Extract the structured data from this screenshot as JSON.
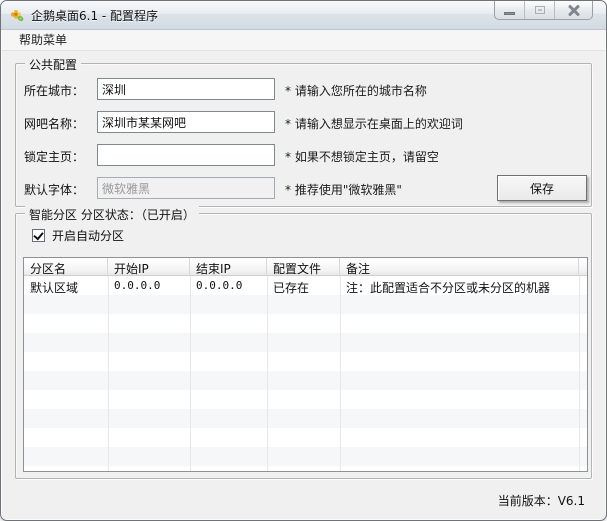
{
  "window": {
    "title": "企鹅桌面6.1 - 配置程序",
    "app_icon": "flower-icon",
    "controls": {
      "minimize": "minimize",
      "maximize": "maximize",
      "close": "close"
    }
  },
  "menu": {
    "help_label": "帮助菜单"
  },
  "common_config": {
    "title": "公共配置",
    "fields": [
      {
        "label": "所在城市：",
        "value": "深圳",
        "hint": "* 请输入您所在的城市名称"
      },
      {
        "label": "网吧名称：",
        "value": "深圳市某某网吧",
        "hint": "* 请输入想显示在桌面上的欢迎词"
      },
      {
        "label": "锁定主页：",
        "value": "",
        "hint": "* 如果不想锁定主页，请留空"
      },
      {
        "label": "默认字体：",
        "value": "微软雅黑",
        "hint": "* 推荐使用\"微软雅黑\""
      }
    ],
    "save_label": "保存"
  },
  "partition": {
    "title": "智能分区 分区状态：（已开启）",
    "checkbox_label": "开启自动分区",
    "checkbox_checked": true,
    "table": {
      "headers": [
        "分区名",
        "开始IP",
        "结束IP",
        "配置文件",
        "备注"
      ],
      "rows": [
        [
          "默认区域",
          "0.0.0.0",
          "0.0.0.0",
          "已存在",
          "注：此配置适合不分区或未分区的机器"
        ]
      ]
    }
  },
  "statusbar": {
    "version_label": "当前版本：V6.1"
  },
  "colors": {
    "client_bg": "#F0F0F0",
    "titlebar_gradient_top": "#f7f9fb",
    "titlebar_gradient_bottom": "#d2dae3",
    "window_border": "#6f7277"
  }
}
